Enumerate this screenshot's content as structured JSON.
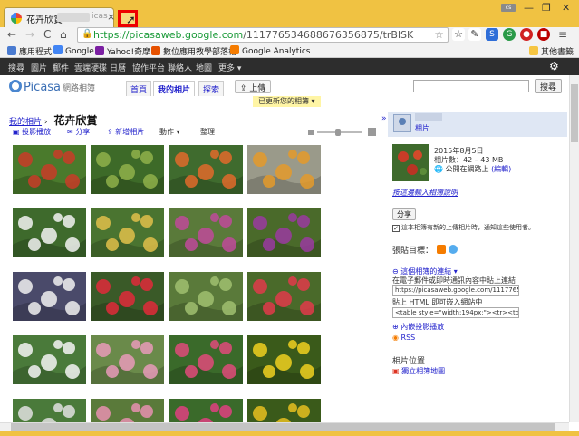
{
  "browser": {
    "tab_title": "花卉欣賞",
    "tab_suffix": "icas",
    "tab_close": "×",
    "user_badge": "cs",
    "url_host": "https://picasaweb.google.com",
    "url_path": "/111776534688676356875/trBlSK",
    "back": "←",
    "forward": "→",
    "reload": "C",
    "home": "⌂",
    "star": "☆",
    "menu": "≡"
  },
  "bookmarks": [
    {
      "label": "應用程式",
      "color": "#4a7bd0"
    },
    {
      "label": "Google",
      "color": "#4285f4"
    },
    {
      "label": "Yahoo!奇摩",
      "color": "#7b1fa2"
    },
    {
      "label": "數位應用教學部落格",
      "color": "#e65100"
    },
    {
      "label": "Google Analytics",
      "color": "#f57c00"
    },
    {
      "label": "其他書籤",
      "color": "#f5c542"
    }
  ],
  "gbar": [
    "搜尋",
    "圖片",
    "郵件",
    "雲端硬碟",
    "日曆",
    "協作平台",
    "聯絡人",
    "地圖",
    "更多 ▾"
  ],
  "picasa": {
    "logo": "Picasa",
    "logo_sub": "網路相簿",
    "tabs": [
      "首頁",
      "我的相片",
      "探索"
    ],
    "upload": "上傳",
    "search_button": "搜尋",
    "notice": "已更新您的相簿",
    "crumb_link": "我的相片",
    "crumb_sep": "›",
    "album_title": "花卉欣賞",
    "album_actions": [
      {
        "label": "投影播放",
        "icon": "slideshow-icon"
      },
      {
        "label": "分享",
        "icon": "mail-icon"
      },
      {
        "label": "新增相片",
        "icon": "add-photo-icon"
      },
      {
        "label": "動作 ▾",
        "icon": ""
      },
      {
        "label": "整理",
        "icon": ""
      }
    ]
  },
  "photos": [
    {
      "bg": "#4a7a2c",
      "accent": "#c83c28"
    },
    {
      "bg": "#3d6a28",
      "accent": "#8fb04a"
    },
    {
      "bg": "#3f6b2e",
      "accent": "#e06a2a"
    },
    {
      "bg": "#9a9a8a",
      "accent": "#e49a2a"
    },
    {
      "bg": "#3e6a2c",
      "accent": "#f2f2f2"
    },
    {
      "bg": "#4a7430",
      "accent": "#e0c04a"
    },
    {
      "bg": "#5a7a3a",
      "accent": "#c04a9a"
    },
    {
      "bg": "#4a6a2a",
      "accent": "#9a3aa0"
    },
    {
      "bg": "#4a4a6a",
      "accent": "#f0f0f0"
    },
    {
      "bg": "#3a5a28",
      "accent": "#e02a3a"
    },
    {
      "bg": "#5a7a3a",
      "accent": "#a0c070"
    },
    {
      "bg": "#4a6a2a",
      "accent": "#e03a4a"
    },
    {
      "bg": "#4a7a3a",
      "accent": "#f4f4f4"
    },
    {
      "bg": "#6a8a4a",
      "accent": "#e89ab8"
    },
    {
      "bg": "#3a6a2a",
      "accent": "#e04a7a"
    },
    {
      "bg": "#3a5a1a",
      "accent": "#f0d020"
    },
    {
      "bg": "#4a7a3a",
      "accent": "#e0e0e0"
    },
    {
      "bg": "#5a7a3a",
      "accent": "#e890b0"
    },
    {
      "bg": "#3a6a2a",
      "accent": "#e04080"
    },
    {
      "bg": "#3a5a1a",
      "accent": "#e8c020"
    }
  ],
  "panel": {
    "collapse": "»",
    "owner_name": "相片",
    "date": "2015年8月5日",
    "count": "相片數：42 – 43 MB",
    "visibility": "公開在網路上",
    "edit": "(編輯)",
    "add_caption": "按這邊輸入相簿說明",
    "share_button": "分享",
    "notify": "這本相簿有新的上傳相片時，通知這些使用者。",
    "blog_label": "張貼目標：",
    "link_label": "這個相簿的連結 ▾",
    "paste_label": "在電子郵件或即時通訊內容中貼上連結",
    "link_value": "https://picasaweb.google.com/11177653",
    "embed_label": "貼上 HTML 即可嵌入網站中",
    "embed_value": "<table style=\"width:194px;\"><tr><td align",
    "embed_slideshow": "內嵌投影播放",
    "rss": "RSS",
    "location_title": "相片位置",
    "location_link": "獨立相簿地圖"
  }
}
